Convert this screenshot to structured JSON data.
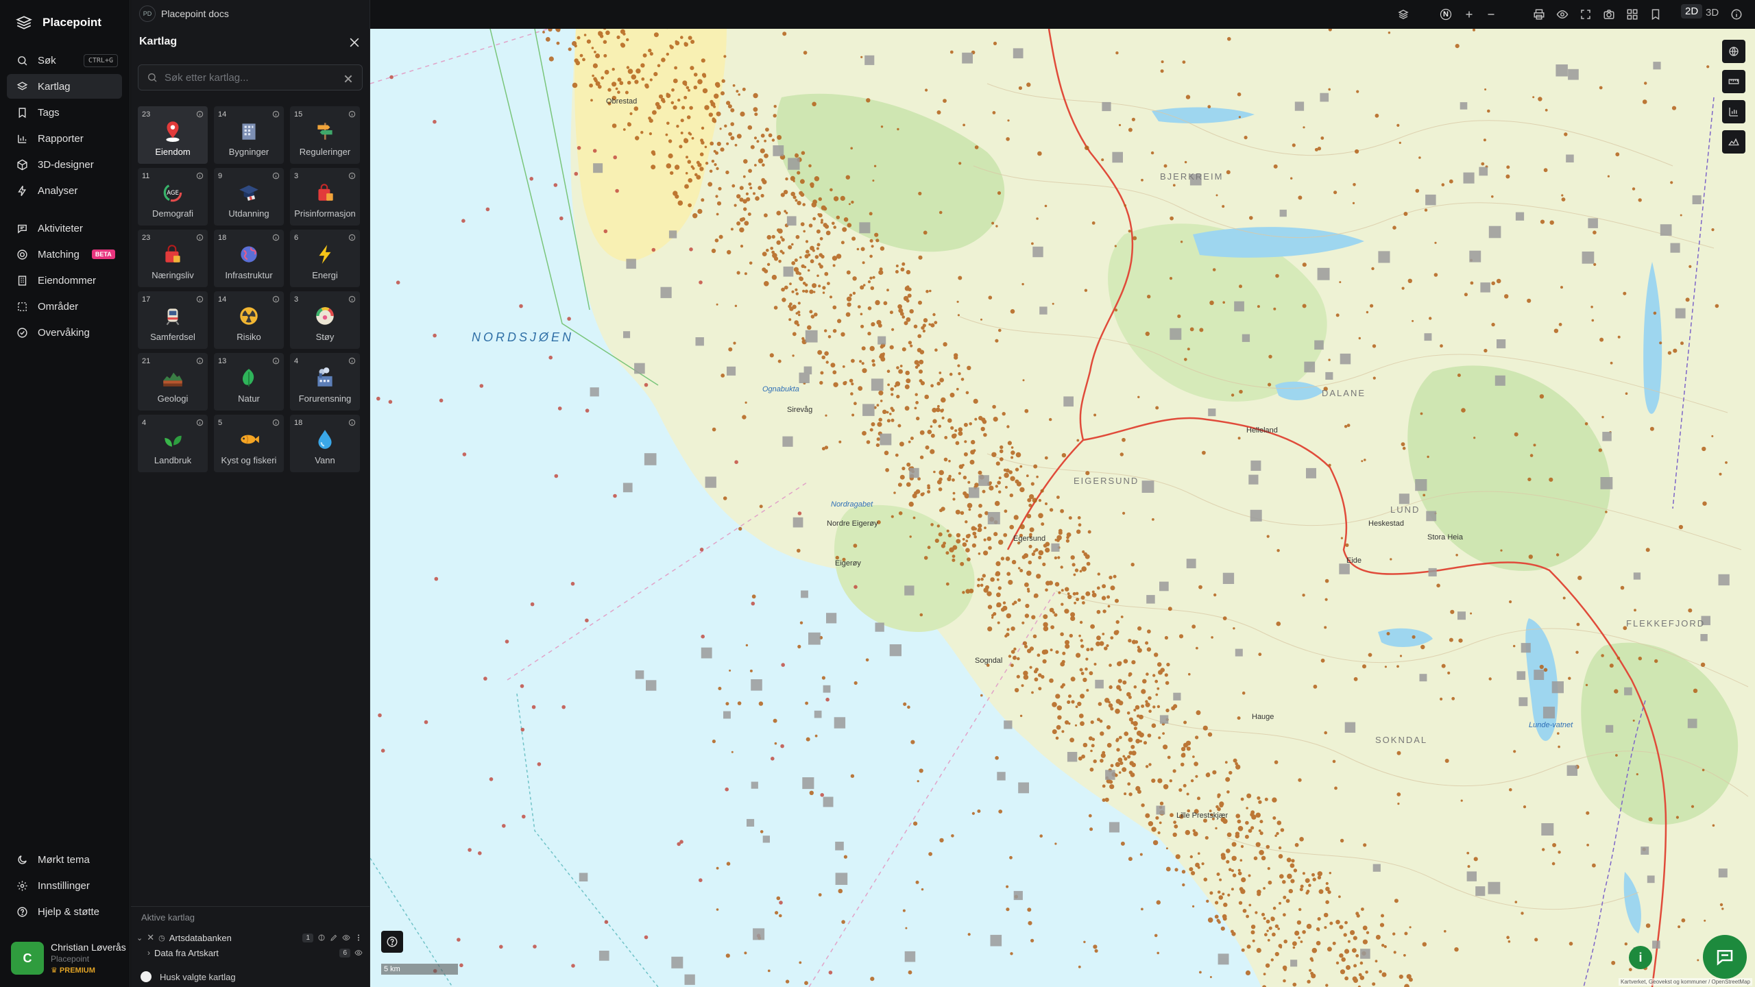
{
  "app": {
    "name": "Placepoint"
  },
  "nav": {
    "primary": [
      {
        "label": "Søk",
        "icon": "search-icon",
        "shortcut": "CTRL+G"
      },
      {
        "label": "Kartlag",
        "icon": "layers-icon",
        "active": true
      },
      {
        "label": "Tags",
        "icon": "bookmark-icon"
      },
      {
        "label": "Rapporter",
        "icon": "bar-chart-icon"
      },
      {
        "label": "3D-designer",
        "icon": "cube-icon"
      },
      {
        "label": "Analyser",
        "icon": "lightning-icon"
      }
    ],
    "secondary": [
      {
        "label": "Aktiviteter",
        "icon": "message-icon"
      },
      {
        "label": "Matching",
        "icon": "target-icon",
        "badge": "BETA"
      },
      {
        "label": "Eiendommer",
        "icon": "building-icon"
      },
      {
        "label": "Områder",
        "icon": "dashed-square-icon"
      },
      {
        "label": "Overvåking",
        "icon": "check-circle-icon"
      }
    ],
    "bottom": [
      {
        "label": "Mørkt tema",
        "icon": "moon-icon"
      },
      {
        "label": "Innstillinger",
        "icon": "gear-icon"
      },
      {
        "label": "Hjelp & støtte",
        "icon": "help-icon"
      }
    ]
  },
  "user": {
    "initial": "C",
    "name": "Christian Løverås",
    "org": "Placepoint",
    "plan": "PREMIUM"
  },
  "doc_tab": {
    "badge": "PD",
    "title": "Placepoint docs"
  },
  "panel": {
    "title": "Kartlag",
    "search_placeholder": "Søk etter kartlag...",
    "tiles": [
      {
        "count": "23",
        "label": "Eiendom",
        "icon": "map-pin-icon",
        "selected": true
      },
      {
        "count": "14",
        "label": "Bygninger",
        "icon": "building-icon"
      },
      {
        "count": "15",
        "label": "Reguleringer",
        "icon": "signpost-icon"
      },
      {
        "count": "11",
        "label": "Demografi",
        "icon": "age-gauge-icon"
      },
      {
        "count": "9",
        "label": "Utdanning",
        "icon": "graduation-cap-icon"
      },
      {
        "count": "3",
        "label": "Prisinformasjon",
        "icon": "shopping-bag-icon"
      },
      {
        "count": "23",
        "label": "Næringsliv",
        "icon": "shop-bag-icon"
      },
      {
        "count": "18",
        "label": "Infrastruktur",
        "icon": "globe-icon"
      },
      {
        "count": "6",
        "label": "Energi",
        "icon": "lightning-icon"
      },
      {
        "count": "17",
        "label": "Samferdsel",
        "icon": "train-icon"
      },
      {
        "count": "14",
        "label": "Risiko",
        "icon": "radiation-icon"
      },
      {
        "count": "3",
        "label": "Støy",
        "icon": "noise-gauge-icon"
      },
      {
        "count": "21",
        "label": "Geologi",
        "icon": "terrain-icon"
      },
      {
        "count": "13",
        "label": "Natur",
        "icon": "leaf-icon"
      },
      {
        "count": "4",
        "label": "Forurensning",
        "icon": "factory-icon"
      },
      {
        "count": "4",
        "label": "Landbruk",
        "icon": "sprout-icon"
      },
      {
        "count": "5",
        "label": "Kyst og fiskeri",
        "icon": "fish-icon"
      },
      {
        "count": "18",
        "label": "Vann",
        "icon": "water-drop-icon"
      }
    ],
    "active_title": "Aktive kartlag",
    "active_layers": [
      {
        "name": "Artsdatabanken",
        "count": "1",
        "expanded": true
      },
      {
        "name": "Data fra Artskart",
        "count": "6",
        "expanded": false
      }
    ],
    "remember_label": "Husk valgte kartlag"
  },
  "topbar": {
    "view_2d": "2D",
    "view_3d": "3D",
    "compass": "N"
  },
  "map": {
    "labels": {
      "sea": "NORDSJØEN",
      "bjerkreim": "BJERKREIM",
      "dalane": "DALANE",
      "eigersund": "EIGERSUND",
      "lund": "LUND",
      "flekkefjord": "FLEKKEFJORD",
      "sokndal": "SOKNDAL",
      "nordragabet": "Nordragabet",
      "nordre_eigeroy": "Nordre Eigerøy",
      "eigeroy": "Eigerøy",
      "egersund": "Egersund",
      "sirevag": "Sirevåg",
      "ognabukta": "Ognabukta",
      "obrestad": "Obrestad",
      "lille_prestskjaer": "Lille Prestskjær",
      "sogndal": "Sogndal",
      "helleland": "Helleland",
      "heskestad": "Heskestad",
      "lundevatnet": "Lunde-vatnet",
      "eide": "Eide",
      "stora_hei": "Stora Heia",
      "hauge": "Hauge"
    },
    "scale": "5 km",
    "attribution": "Kartverket, Geovekst og kommuner / OpenStreetMap"
  }
}
